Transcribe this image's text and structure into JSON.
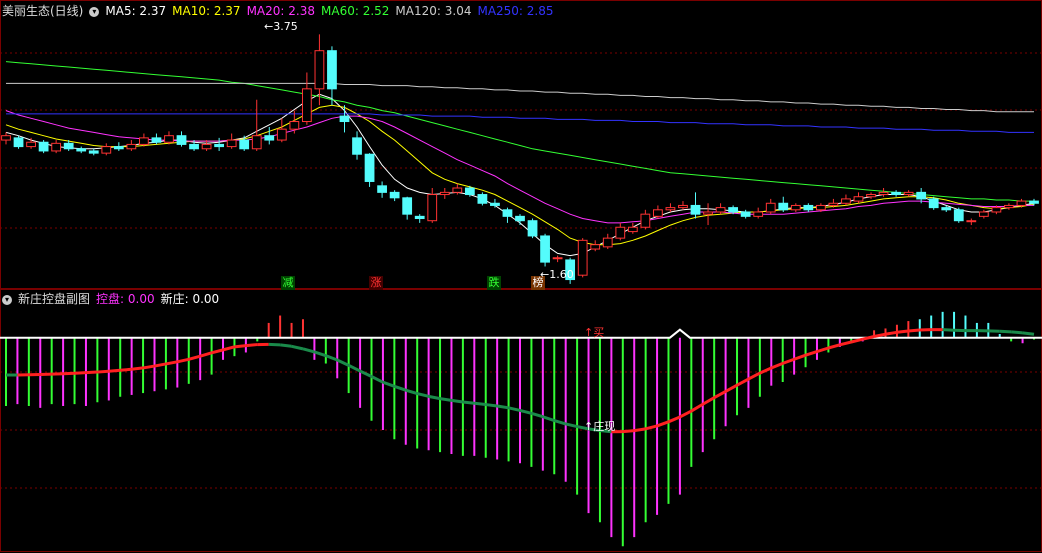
{
  "top_legend": {
    "title": "美丽生态(日线)",
    "items": [
      {
        "label": "MA5: 2.37",
        "color": "#ffffff"
      },
      {
        "label": "MA10: 2.37",
        "color": "#ffff00"
      },
      {
        "label": "MA20: 2.38",
        "color": "#ff33ff"
      },
      {
        "label": "MA60: 2.52",
        "color": "#33ff33"
      },
      {
        "label": "MA120: 3.04",
        "color": "#cccccc"
      },
      {
        "label": "MA250: 2.85",
        "color": "#3333ff"
      }
    ]
  },
  "sub_legend": {
    "title": "新庄控盘副图",
    "items": [
      {
        "label": "控盘: 0.00",
        "color": "#ff33ff"
      },
      {
        "label": "新庄: 0.00",
        "color": "#ffffff"
      }
    ]
  },
  "signals": [
    {
      "text": "减",
      "color": "#33ff33",
      "bg": "#004400"
    },
    {
      "text": "涨",
      "color": "#ff3333",
      "bg": "#440000"
    },
    {
      "text": "跌",
      "color": "#33ff33",
      "bg": "#004400"
    },
    {
      "text": "榜",
      "color": "#ffffff",
      "bg": "#773300"
    }
  ],
  "annotations": {
    "high_label": "3.75",
    "low_label": "1.60",
    "buy_label": "买",
    "zhuang_label": "庄现"
  },
  "chart_data": [
    {
      "type": "candlestick",
      "title": "美丽生态(日线)",
      "ylim": [
        1.45,
        3.9
      ],
      "candles": [
        [
          2.78,
          2.82,
          2.85,
          2.74
        ],
        [
          2.8,
          2.72,
          2.82,
          2.7
        ],
        [
          2.72,
          2.76,
          2.8,
          2.7
        ],
        [
          2.76,
          2.68,
          2.78,
          2.66
        ],
        [
          2.68,
          2.75,
          2.78,
          2.66
        ],
        [
          2.75,
          2.7,
          2.78,
          2.68
        ],
        [
          2.7,
          2.68,
          2.72,
          2.66
        ],
        [
          2.68,
          2.66,
          2.7,
          2.64
        ],
        [
          2.66,
          2.72,
          2.75,
          2.64
        ],
        [
          2.72,
          2.7,
          2.76,
          2.68
        ],
        [
          2.7,
          2.74,
          2.78,
          2.68
        ],
        [
          2.74,
          2.8,
          2.84,
          2.72
        ],
        [
          2.8,
          2.76,
          2.84,
          2.74
        ],
        [
          2.76,
          2.82,
          2.86,
          2.74
        ],
        [
          2.82,
          2.74,
          2.86,
          2.72
        ],
        [
          2.74,
          2.7,
          2.78,
          2.68
        ],
        [
          2.7,
          2.74,
          2.78,
          2.68
        ],
        [
          2.74,
          2.72,
          2.8,
          2.68
        ],
        [
          2.72,
          2.78,
          2.84,
          2.7
        ],
        [
          2.78,
          2.7,
          2.82,
          2.68
        ],
        [
          2.7,
          2.82,
          3.15,
          2.68
        ],
        [
          2.82,
          2.78,
          2.9,
          2.74
        ],
        [
          2.78,
          2.88,
          2.98,
          2.76
        ],
        [
          2.88,
          2.95,
          3.05,
          2.84
        ],
        [
          2.95,
          3.25,
          3.4,
          2.92
        ],
        [
          3.25,
          3.6,
          3.75,
          3.1
        ],
        [
          3.6,
          3.25,
          3.64,
          3.1
        ],
        [
          3.0,
          2.95,
          3.1,
          2.85
        ],
        [
          2.8,
          2.65,
          2.86,
          2.6
        ],
        [
          2.65,
          2.4,
          2.66,
          2.35
        ],
        [
          2.36,
          2.3,
          2.4,
          2.25
        ],
        [
          2.3,
          2.25,
          2.32,
          2.22
        ],
        [
          2.25,
          2.1,
          2.26,
          2.05
        ],
        [
          2.08,
          2.06,
          2.1,
          2.02
        ],
        [
          2.04,
          2.28,
          2.34,
          2.02
        ],
        [
          2.28,
          2.3,
          2.34,
          2.24
        ],
        [
          2.3,
          2.34,
          2.38,
          2.28
        ],
        [
          2.34,
          2.28,
          2.36,
          2.26
        ],
        [
          2.28,
          2.2,
          2.3,
          2.18
        ],
        [
          2.2,
          2.18,
          2.24,
          2.16
        ],
        [
          2.14,
          2.08,
          2.16,
          2.02
        ],
        [
          2.08,
          2.04,
          2.1,
          2.0
        ],
        [
          2.04,
          1.9,
          2.06,
          1.88
        ],
        [
          1.9,
          1.66,
          1.92,
          1.62
        ],
        [
          1.7,
          1.7,
          1.72,
          1.66
        ],
        [
          1.68,
          1.5,
          1.7,
          1.46
        ],
        [
          1.54,
          1.86,
          1.88,
          1.52
        ],
        [
          1.78,
          1.82,
          1.86,
          1.76
        ],
        [
          1.8,
          1.88,
          1.92,
          1.78
        ],
        [
          1.88,
          1.98,
          2.02,
          1.86
        ],
        [
          1.94,
          1.98,
          2.02,
          1.92
        ],
        [
          1.98,
          2.1,
          2.14,
          1.96
        ],
        [
          2.08,
          2.14,
          2.18,
          2.06
        ],
        [
          2.14,
          2.16,
          2.2,
          2.12
        ],
        [
          2.16,
          2.18,
          2.22,
          2.14
        ],
        [
          2.18,
          2.1,
          2.3,
          2.06
        ],
        [
          2.1,
          2.12,
          2.2,
          2.0
        ],
        [
          2.12,
          2.16,
          2.2,
          2.1
        ],
        [
          2.16,
          2.12,
          2.18,
          2.1
        ],
        [
          2.12,
          2.08,
          2.14,
          2.06
        ],
        [
          2.08,
          2.12,
          2.16,
          2.06
        ],
        [
          2.12,
          2.2,
          2.24,
          2.1
        ],
        [
          2.2,
          2.14,
          2.26,
          2.12
        ],
        [
          2.14,
          2.18,
          2.2,
          2.12
        ],
        [
          2.18,
          2.14,
          2.2,
          2.12
        ],
        [
          2.14,
          2.18,
          2.2,
          2.12
        ],
        [
          2.18,
          2.2,
          2.24,
          2.16
        ],
        [
          2.2,
          2.24,
          2.28,
          2.18
        ],
        [
          2.22,
          2.26,
          2.3,
          2.2
        ],
        [
          2.26,
          2.28,
          2.3,
          2.24
        ],
        [
          2.28,
          2.3,
          2.34,
          2.26
        ],
        [
          2.3,
          2.28,
          2.32,
          2.26
        ],
        [
          2.28,
          2.3,
          2.32,
          2.26
        ],
        [
          2.3,
          2.24,
          2.34,
          2.2
        ],
        [
          2.24,
          2.16,
          2.26,
          2.14
        ],
        [
          2.16,
          2.14,
          2.18,
          2.12
        ],
        [
          2.14,
          2.04,
          2.16,
          2.02
        ],
        [
          2.04,
          2.04,
          2.06,
          2.0
        ],
        [
          2.08,
          2.12,
          2.14,
          2.06
        ],
        [
          2.12,
          2.16,
          2.18,
          2.1
        ],
        [
          2.16,
          2.18,
          2.2,
          2.14
        ],
        [
          2.18,
          2.22,
          2.24,
          2.16
        ],
        [
          2.22,
          2.2,
          2.24,
          2.18
        ]
      ],
      "series": [
        {
          "name": "MA5",
          "color": "#ffffff",
          "values": [
            2.85,
            2.82,
            2.78,
            2.75,
            2.72,
            2.71,
            2.7,
            2.7,
            2.71,
            2.72,
            2.73,
            2.75,
            2.76,
            2.78,
            2.78,
            2.76,
            2.75,
            2.76,
            2.78,
            2.8,
            2.86,
            2.92,
            2.98,
            3.06,
            3.14,
            3.2,
            3.16,
            3.05,
            2.9,
            2.72,
            2.55,
            2.42,
            2.34,
            2.3,
            2.28,
            2.29,
            2.3,
            2.28,
            2.24,
            2.18,
            2.1,
            2.02,
            1.92,
            1.82,
            1.74,
            1.72,
            1.74,
            1.8,
            1.86,
            1.92,
            1.98,
            2.04,
            2.08,
            2.12,
            2.14,
            2.15,
            2.15,
            2.14,
            2.13,
            2.12,
            2.12,
            2.13,
            2.15,
            2.16,
            2.16,
            2.17,
            2.19,
            2.21,
            2.24,
            2.26,
            2.28,
            2.28,
            2.28,
            2.26,
            2.22,
            2.18,
            2.14,
            2.12,
            2.12,
            2.14,
            2.16,
            2.18,
            2.2
          ]
        },
        {
          "name": "MA10",
          "color": "#ffff00",
          "values": [
            2.92,
            2.88,
            2.85,
            2.82,
            2.79,
            2.77,
            2.75,
            2.73,
            2.72,
            2.72,
            2.72,
            2.73,
            2.74,
            2.75,
            2.76,
            2.77,
            2.77,
            2.77,
            2.78,
            2.79,
            2.82,
            2.86,
            2.9,
            2.96,
            3.02,
            3.08,
            3.1,
            3.08,
            3.02,
            2.95,
            2.86,
            2.78,
            2.68,
            2.58,
            2.48,
            2.42,
            2.38,
            2.35,
            2.32,
            2.28,
            2.22,
            2.16,
            2.1,
            2.03,
            1.96,
            1.88,
            1.84,
            1.82,
            1.82,
            1.83,
            1.86,
            1.9,
            1.95,
            2.0,
            2.04,
            2.07,
            2.09,
            2.1,
            2.11,
            2.12,
            2.12,
            2.13,
            2.14,
            2.15,
            2.16,
            2.16,
            2.17,
            2.18,
            2.2,
            2.22,
            2.24,
            2.25,
            2.26,
            2.26,
            2.25,
            2.23,
            2.2,
            2.18,
            2.16,
            2.15,
            2.16,
            2.17,
            2.19
          ]
        },
        {
          "name": "MA20",
          "color": "#ff33ff",
          "values": [
            3.05,
            3.01,
            2.98,
            2.95,
            2.92,
            2.89,
            2.87,
            2.85,
            2.83,
            2.81,
            2.8,
            2.79,
            2.78,
            2.78,
            2.77,
            2.77,
            2.77,
            2.77,
            2.78,
            2.78,
            2.79,
            2.81,
            2.84,
            2.87,
            2.9,
            2.94,
            2.98,
            3.0,
            3.0,
            2.98,
            2.95,
            2.9,
            2.84,
            2.78,
            2.72,
            2.66,
            2.6,
            2.55,
            2.5,
            2.45,
            2.38,
            2.32,
            2.26,
            2.2,
            2.15,
            2.1,
            2.06,
            2.04,
            2.02,
            2.02,
            2.03,
            2.04,
            2.06,
            2.08,
            2.1,
            2.12,
            2.12,
            2.12,
            2.11,
            2.1,
            2.1,
            2.1,
            2.1,
            2.11,
            2.12,
            2.13,
            2.14,
            2.15,
            2.17,
            2.18,
            2.2,
            2.21,
            2.22,
            2.22,
            2.21,
            2.2,
            2.19,
            2.18,
            2.17,
            2.17,
            2.17,
            2.18,
            2.18
          ]
        },
        {
          "name": "MA60",
          "color": "#33ff33",
          "values": [
            3.5,
            3.49,
            3.48,
            3.47,
            3.46,
            3.45,
            3.44,
            3.43,
            3.42,
            3.41,
            3.4,
            3.39,
            3.38,
            3.37,
            3.36,
            3.35,
            3.34,
            3.33,
            3.31,
            3.3,
            3.28,
            3.26,
            3.24,
            3.22,
            3.2,
            3.18,
            3.15,
            3.13,
            3.1,
            3.08,
            3.05,
            3.03,
            3.0,
            2.97,
            2.94,
            2.91,
            2.88,
            2.85,
            2.82,
            2.79,
            2.76,
            2.73,
            2.7,
            2.68,
            2.66,
            2.64,
            2.62,
            2.6,
            2.58,
            2.56,
            2.54,
            2.52,
            2.5,
            2.48,
            2.47,
            2.46,
            2.45,
            2.44,
            2.43,
            2.42,
            2.41,
            2.4,
            2.39,
            2.38,
            2.37,
            2.36,
            2.35,
            2.34,
            2.33,
            2.32,
            2.31,
            2.3,
            2.29,
            2.28,
            2.27,
            2.26,
            2.25,
            2.24,
            2.24,
            2.23,
            2.23,
            2.22,
            2.22
          ]
        },
        {
          "name": "MA120",
          "color": "#cccccc",
          "values": [
            3.3,
            3.3,
            3.3,
            3.3,
            3.3,
            3.3,
            3.3,
            3.3,
            3.3,
            3.3,
            3.3,
            3.3,
            3.3,
            3.3,
            3.3,
            3.3,
            3.3,
            3.3,
            3.3,
            3.3,
            3.3,
            3.3,
            3.3,
            3.3,
            3.3,
            3.3,
            3.3,
            3.29,
            3.29,
            3.29,
            3.28,
            3.28,
            3.28,
            3.27,
            3.27,
            3.26,
            3.26,
            3.25,
            3.25,
            3.24,
            3.24,
            3.23,
            3.23,
            3.22,
            3.22,
            3.21,
            3.21,
            3.2,
            3.2,
            3.19,
            3.19,
            3.18,
            3.18,
            3.17,
            3.17,
            3.16,
            3.16,
            3.15,
            3.15,
            3.14,
            3.14,
            3.13,
            3.13,
            3.12,
            3.12,
            3.11,
            3.11,
            3.1,
            3.1,
            3.09,
            3.09,
            3.08,
            3.08,
            3.07,
            3.07,
            3.06,
            3.06,
            3.05,
            3.05,
            3.04,
            3.04,
            3.04,
            3.04
          ]
        },
        {
          "name": "MA250",
          "color": "#3333ff",
          "values": [
            3.02,
            3.02,
            3.02,
            3.02,
            3.02,
            3.02,
            3.02,
            3.02,
            3.02,
            3.02,
            3.02,
            3.02,
            3.02,
            3.02,
            3.02,
            3.02,
            3.02,
            3.02,
            3.02,
            3.02,
            3.02,
            3.02,
            3.02,
            3.02,
            3.02,
            3.02,
            3.02,
            3.02,
            3.02,
            3.02,
            3.01,
            3.01,
            3.01,
            3.01,
            3.0,
            3.0,
            3.0,
            3.0,
            2.99,
            2.99,
            2.99,
            2.98,
            2.98,
            2.98,
            2.97,
            2.97,
            2.97,
            2.96,
            2.96,
            2.96,
            2.95,
            2.95,
            2.95,
            2.94,
            2.94,
            2.94,
            2.93,
            2.93,
            2.93,
            2.92,
            2.92,
            2.92,
            2.91,
            2.91,
            2.91,
            2.9,
            2.9,
            2.9,
            2.89,
            2.89,
            2.89,
            2.88,
            2.88,
            2.88,
            2.87,
            2.87,
            2.87,
            2.86,
            2.86,
            2.86,
            2.85,
            2.85,
            2.85
          ]
        }
      ]
    },
    {
      "type": "bar",
      "title": "新庄控盘副图",
      "ylim": [
        -115,
        15
      ],
      "bars": [
        -37,
        -36,
        -37,
        -38,
        -36,
        -37,
        -36,
        -37,
        -35,
        -34,
        -32,
        -31,
        -30,
        -29,
        -28,
        -27,
        -25,
        -23,
        -20,
        -12,
        -10,
        -8,
        -2,
        8,
        12,
        8,
        10,
        -12,
        -14,
        -22,
        -30,
        -38,
        -45,
        -50,
        -55,
        -58,
        -60,
        -61,
        -62,
        -63,
        -64,
        -64,
        -65,
        -66,
        -67,
        -68,
        -70,
        -72,
        -74,
        -78,
        -85,
        -95,
        -100,
        -108,
        -113,
        -108,
        -100,
        -96,
        -90,
        -85,
        -70,
        -62,
        -55,
        -48,
        -42,
        -38,
        -32,
        -26,
        -24,
        -20,
        -16,
        -12,
        -8,
        -5,
        -3,
        -2,
        4,
        5,
        7,
        9,
        10,
        12,
        14,
        14,
        12,
        8,
        8,
        2,
        -2,
        -3,
        -1
      ]
    }
  ]
}
